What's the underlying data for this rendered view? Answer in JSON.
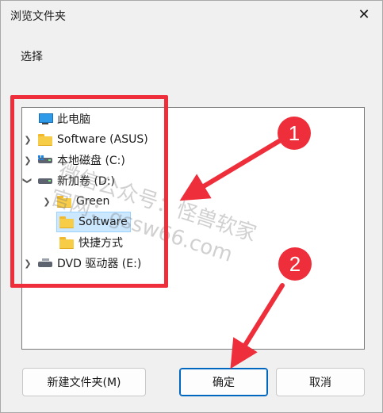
{
  "dialog": {
    "title": "浏览文件夹",
    "close_glyph": "✕",
    "prompt": "选择"
  },
  "tree": {
    "items": [
      {
        "label": "此电脑",
        "icon": "computer-icon",
        "level": 0
      },
      {
        "label": "Software (ASUS)",
        "icon": "folder-icon",
        "chevron": ">",
        "level": 1
      },
      {
        "label": "本地磁盘 (C:)",
        "icon": "windows-drive-icon",
        "chevron": ">",
        "level": 1
      },
      {
        "label": "新加卷 (D:)",
        "icon": "drive-icon",
        "chevron": "v",
        "expanded": true,
        "level": 1
      },
      {
        "label": "Green",
        "icon": "folder-icon",
        "chevron": ">",
        "level": 2
      },
      {
        "label": "Software",
        "icon": "folder-icon",
        "level": 2,
        "selected": true
      },
      {
        "label": "快捷方式",
        "icon": "folder-icon",
        "level": 2
      },
      {
        "label": "DVD 驱动器 (E:)",
        "icon": "dvd-drive-icon",
        "chevron": ">",
        "level": 1
      }
    ]
  },
  "buttons": {
    "new_folder": "新建文件夹(M)",
    "ok": "确定",
    "cancel": "取消"
  },
  "annotations": {
    "badge1": "1",
    "badge2": "2",
    "accent_color": "#ee2e3a"
  },
  "watermark": {
    "line1": "微信公众号：怪兽软家",
    "line2": "官网：gssw66.com"
  }
}
